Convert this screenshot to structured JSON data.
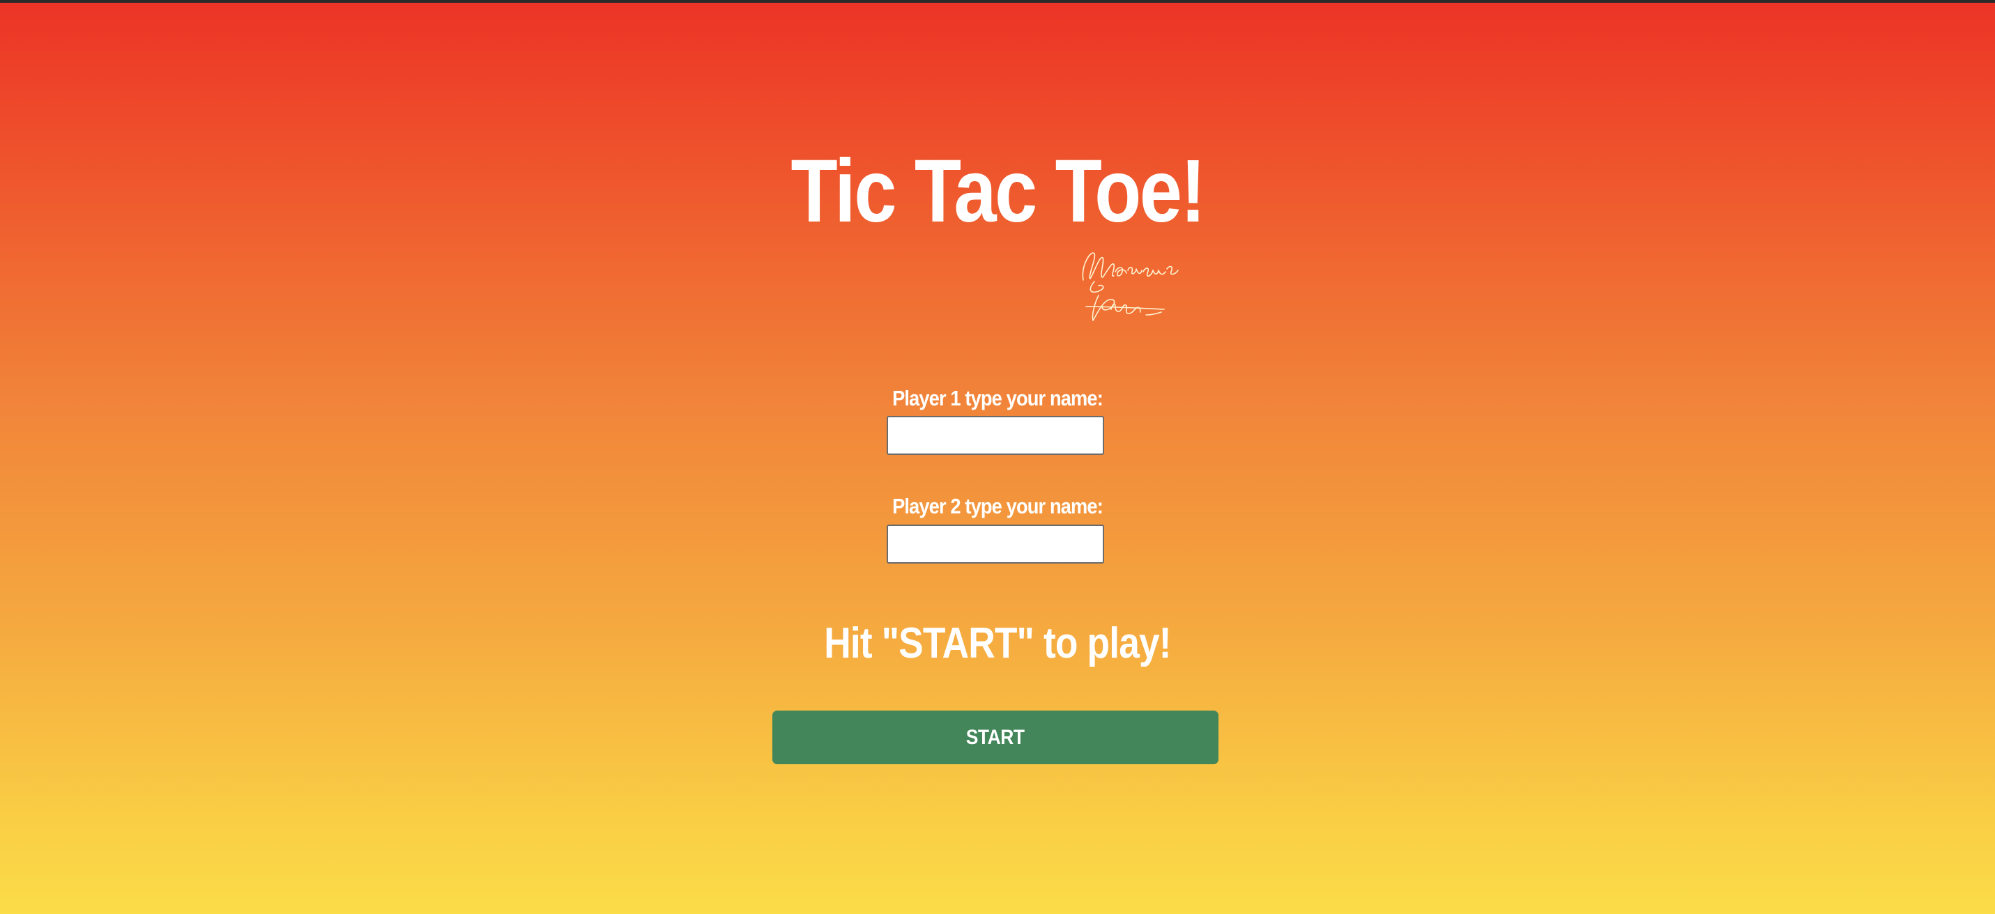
{
  "page": {
    "title": "Tic Tac Toe!",
    "signature_text": "Marquise Alton"
  },
  "form": {
    "player1": {
      "label": "Player 1 type your name:",
      "value": "",
      "placeholder": ""
    },
    "player2": {
      "label": "Player 2 type your name:",
      "value": "",
      "placeholder": ""
    }
  },
  "prompt": "Hit \"START\" to play!",
  "start_button": {
    "label": "START"
  },
  "colors": {
    "gradient_top": "#ec3326",
    "gradient_bottom": "#fbdd48",
    "start_button": "#42865a",
    "text": "#ffffff"
  }
}
